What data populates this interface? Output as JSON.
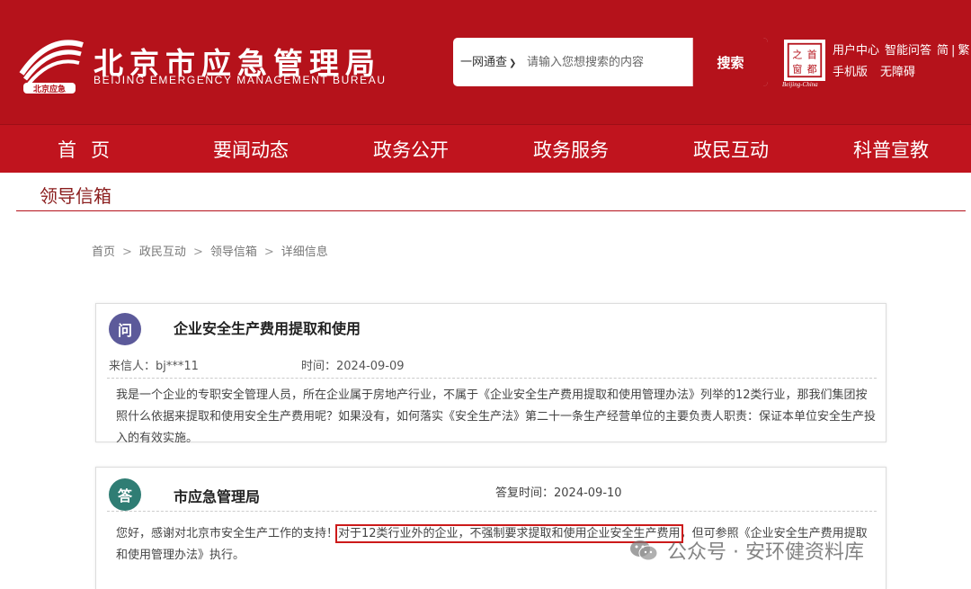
{
  "header": {
    "title": "北京市应急管理局",
    "subtitle": "BEIJING EMERGENCY MANAGEMENT BUREAU",
    "logo_icon": "bureau-emblem-icon",
    "capital_logo_icon": "capital-seal-icon",
    "capital_caption": "Beijing-China",
    "links": [
      "用户中心",
      "智能问答",
      "简",
      "|",
      "繁",
      "手机版",
      "无障碍"
    ]
  },
  "search": {
    "scope": "一网通查",
    "placeholder": "请输入您想搜索的内容",
    "button": "搜索"
  },
  "nav": {
    "items": [
      "首页",
      "要闻动态",
      "政务公开",
      "政务服务",
      "政民互动",
      "科普宣教"
    ]
  },
  "page": {
    "title": "领导信箱",
    "breadcrumb": [
      "首页",
      "政民互动",
      "领导信箱",
      "详细信息"
    ]
  },
  "question": {
    "badge": "问",
    "title": "企业安全生产费用提取和使用",
    "sender_label": "来信人：bj***11",
    "time_label": "时间：2024-09-09",
    "body": "我是一个企业的专职安全管理人员，所在企业属于房地产行业，不属于《企业安全生产费用提取和使用管理办法》列举的12类行业，那我们集团按照什么依据来提取和使用安全生产费用呢？如果没有，如何落实《安全生产法》第二十一条生产经营单位的主要负责人职责：保证本单位安全生产投入的有效实施。"
  },
  "answer": {
    "badge": "答",
    "title": "市应急管理局",
    "reply_time_label": "答复时间：2024-09-10",
    "body_before": "您好，感谢对北京市安全生产工作的支持！",
    "body_highlight": "对于12类行业外的企业，不强制要求提取和使用企业安全生产费用",
    "body_after": "，但可参照《企业安全生产费用提取和使用管理办法》执行。"
  },
  "watermark": {
    "icon": "wechat-icon",
    "text": "公众号 · 安环健资料库"
  },
  "colors": {
    "brand_red": "#b5121b",
    "nav_red": "#c0141e",
    "question_badge": "#5c5a9a",
    "answer_badge": "#2f7d74",
    "highlight_border": "#cc1a1a"
  }
}
